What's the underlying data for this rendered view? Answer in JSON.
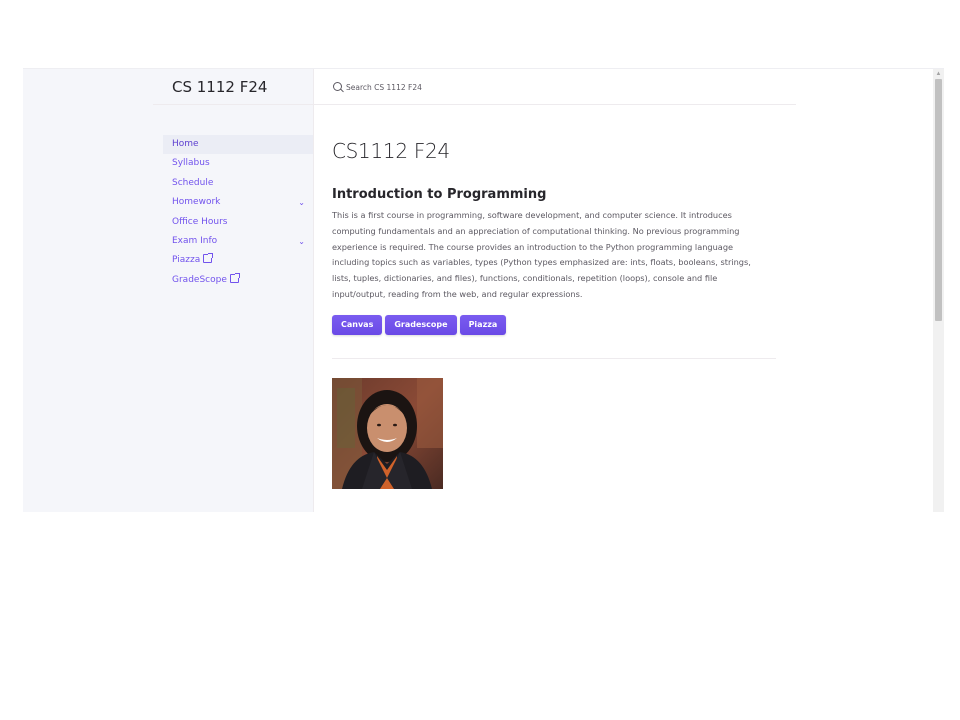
{
  "site": {
    "title": "CS 1112 F24"
  },
  "search": {
    "placeholder": "Search CS 1112 F24"
  },
  "nav": {
    "items": [
      {
        "label": "Home",
        "active": true,
        "expandable": false,
        "external": false
      },
      {
        "label": "Syllabus",
        "active": false,
        "expandable": false,
        "external": false
      },
      {
        "label": "Schedule",
        "active": false,
        "expandable": false,
        "external": false
      },
      {
        "label": "Homework",
        "active": false,
        "expandable": true,
        "external": false
      },
      {
        "label": "Office Hours",
        "active": false,
        "expandable": false,
        "external": false
      },
      {
        "label": "Exam Info",
        "active": false,
        "expandable": true,
        "external": false
      },
      {
        "label": "Piazza",
        "active": false,
        "expandable": false,
        "external": true
      },
      {
        "label": "GradeScope",
        "active": false,
        "expandable": false,
        "external": true
      }
    ]
  },
  "main": {
    "title": "CS1112 F24",
    "subtitle": "Introduction to Programming",
    "description": "This is a first course in programming, software development, and computer science. It introduces computing fundamentals and an appreciation of computational thinking. No previous programming experience is required. The course provides an introduction to the Python programming language including topics such as variables, types (Python types emphasized are: ints, floats, booleans, strings, lists, tuples, dictionaries, and files), functions, conditionals, repetition (loops), console and file input/output, reading from the web, and regular expressions.",
    "buttons": [
      {
        "label": "Canvas"
      },
      {
        "label": "Gradescope"
      },
      {
        "label": "Piazza"
      }
    ]
  },
  "colors": {
    "accent": "#7253ed",
    "sidebar_bg": "#f5f6fa",
    "text": "#27262b",
    "muted_text": "#5c5962"
  },
  "icons": {
    "search": "search-icon",
    "chevron": "chevron-down-icon",
    "external": "external-link-icon"
  }
}
